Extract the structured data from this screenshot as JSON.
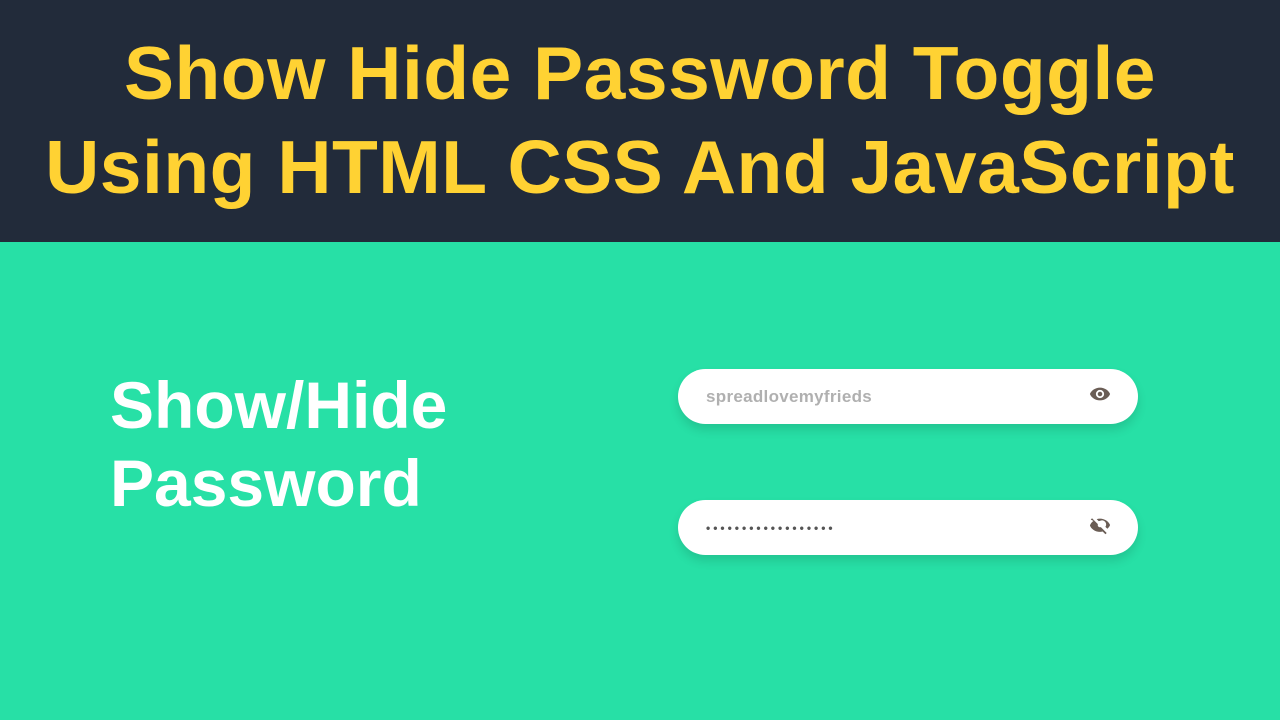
{
  "banner": {
    "title": "Show Hide Password Toggle Using HTML CSS And JavaScript"
  },
  "stage": {
    "heading_line1": "Show/Hide",
    "heading_line2": "Password",
    "visible_input": {
      "value": "spreadlovemyfrieds"
    },
    "hidden_input": {
      "mask": "••••••••••••••••••"
    }
  },
  "colors": {
    "banner_bg": "#222b3a",
    "banner_text": "#ffd233",
    "stage_bg": "#27e0a6",
    "heading_text": "#ffffff"
  }
}
